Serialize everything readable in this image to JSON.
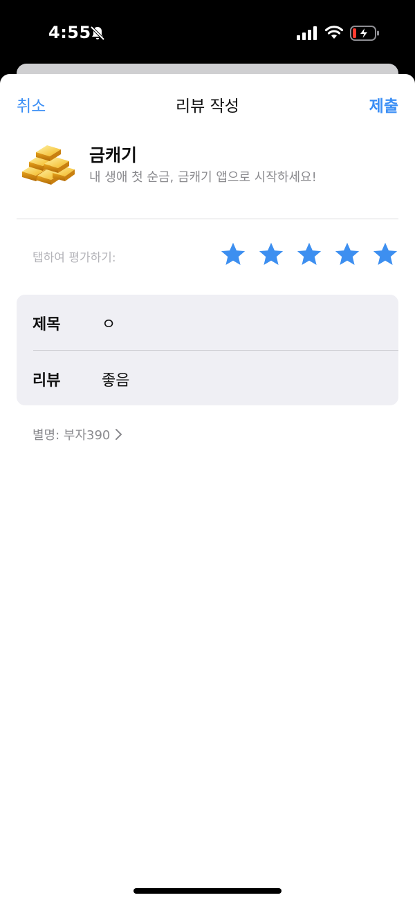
{
  "status_bar": {
    "time": "4:55",
    "icons": [
      "bell-slash-icon",
      "signal-icon",
      "wifi-icon",
      "battery-charging-icon"
    ]
  },
  "nav": {
    "cancel_label": "취소",
    "title": "리뷰 작성",
    "submit_label": "제출"
  },
  "app": {
    "icon": "gold-bars-icon",
    "name": "금캐기",
    "subtitle": "내 생애 첫 순금, 금캐기 앱으로 시작하세요!"
  },
  "rating": {
    "label": "탭하여 평가하기:",
    "value": 5,
    "max": 5
  },
  "form": {
    "title_label": "제목",
    "title_value": "ㅇ",
    "review_label": "리뷰",
    "review_value": "좋음"
  },
  "nickname": {
    "text": "별명: 부자390"
  },
  "colors": {
    "accent": "#3a8ef5",
    "star": "#3d8ff0",
    "card_bg": "#efeff4"
  }
}
